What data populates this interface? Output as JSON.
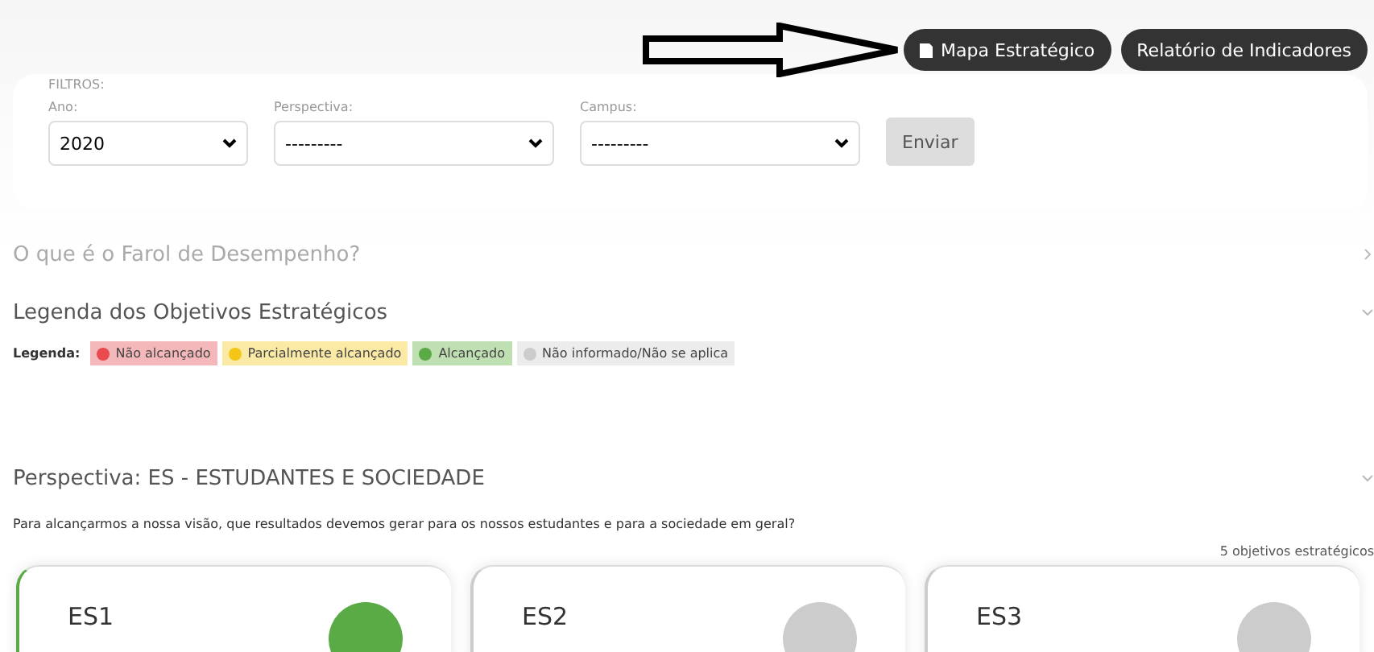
{
  "header_buttons": [
    {
      "label": "Mapa Estratégico",
      "icon": true
    },
    {
      "label": "Relatório de Indicadores",
      "icon": false
    }
  ],
  "filters": {
    "title": "FILTROS:",
    "fields": [
      {
        "label": "Ano:",
        "value": "2020"
      },
      {
        "label": "Perspectiva:",
        "value": "---------"
      },
      {
        "label": "Campus:",
        "value": "---------"
      }
    ],
    "submit": "Enviar"
  },
  "accordions": [
    {
      "title": "O que é o Farol de Desempenho?",
      "expanded": false
    },
    {
      "title": "Legenda dos Objetivos Estratégicos",
      "expanded": true
    }
  ],
  "legend": {
    "label": "Legenda:",
    "items": [
      {
        "text": "Não alcançado",
        "color": "#e84a4f"
      },
      {
        "text": "Parcialmente alcançado",
        "color": "#f5c518"
      },
      {
        "text": "Alcançado",
        "color": "#5aaa46"
      },
      {
        "text": "Não informado/Não se aplica",
        "color": "#cccccc"
      }
    ]
  },
  "perspective": {
    "title": "Perspectiva: ES - ESTUDANTES E SOCIEDADE",
    "expanded": true,
    "question": "Para alcançarmos a nossa visão, que resultados devemos gerar para os nossos estudantes e para a sociedade em geral?",
    "count": "5 objetivos estratégicos",
    "cards": [
      {
        "code": "ES1",
        "color": "#5aaa46"
      },
      {
        "code": "ES2",
        "color": "#cccccc"
      },
      {
        "code": "ES3",
        "color": "#cccccc"
      }
    ]
  }
}
